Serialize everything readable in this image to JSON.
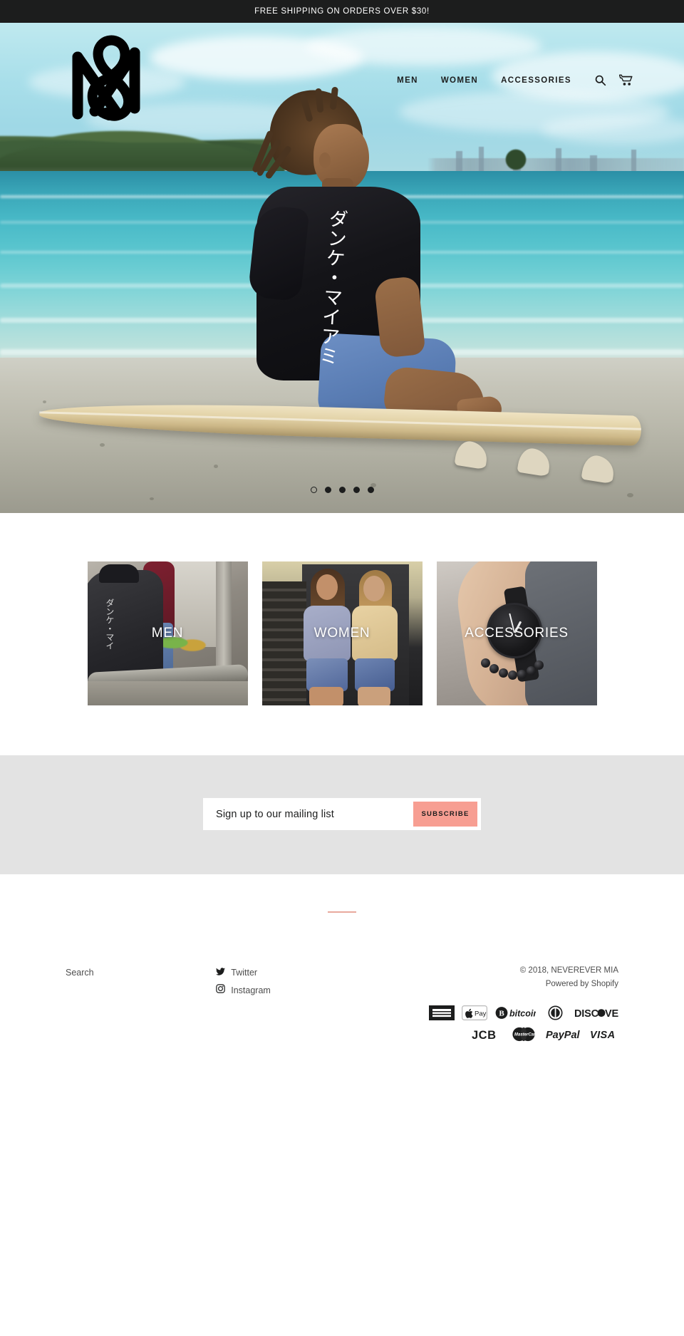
{
  "announcement": {
    "text": "FREE SHIPPING ON ORDERS OVER $30!"
  },
  "header": {
    "logo_alt": "NEVEREVER MIA",
    "nav": [
      {
        "label": "MEN"
      },
      {
        "label": "WOMEN"
      },
      {
        "label": "ACCESSORIES"
      }
    ],
    "icons": [
      {
        "name": "search-icon",
        "label": "Search"
      },
      {
        "name": "cart-icon",
        "label": "Cart"
      }
    ]
  },
  "hero": {
    "shirt_text": "ダンケ・マイアミ",
    "slides_total": 5,
    "active_slide": 1
  },
  "collections": [
    {
      "label": "MEN"
    },
    {
      "label": "WOMEN"
    },
    {
      "label": "ACCESSORIES"
    }
  ],
  "newsletter": {
    "placeholder": "Sign up to our mailing list",
    "value": "",
    "button_label": "SUBSCRIBE",
    "button_color": "#f79e92",
    "background": "#e3e3e3"
  },
  "footer": {
    "rule_color": "#e9a99d",
    "links": [
      {
        "label": "Search"
      }
    ],
    "social": [
      {
        "icon": "twitter-icon",
        "label": "Twitter"
      },
      {
        "icon": "instagram-icon",
        "label": "Instagram"
      }
    ],
    "copyright": "© 2018, NEVEREVER MIA",
    "powered_by": "Powered by Shopify",
    "payment_methods": [
      {
        "name": "american-express"
      },
      {
        "name": "apple-pay"
      },
      {
        "name": "bitcoin"
      },
      {
        "name": "diners-club"
      },
      {
        "name": "discover"
      },
      {
        "name": "jcb"
      },
      {
        "name": "mastercard"
      },
      {
        "name": "paypal"
      },
      {
        "name": "visa"
      }
    ]
  }
}
